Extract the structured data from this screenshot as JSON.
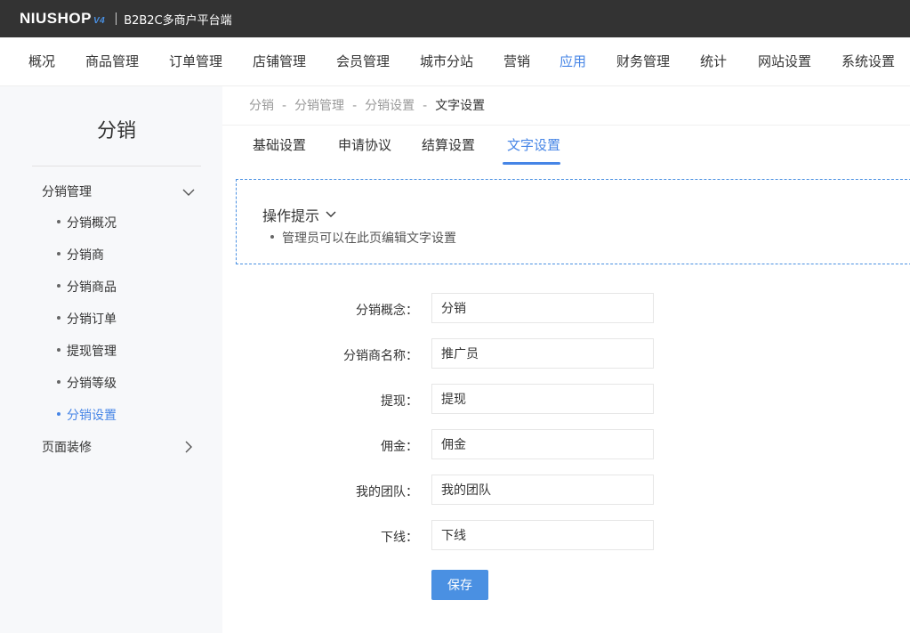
{
  "header": {
    "logo_text": "NIUSHOP",
    "logo_version": "V4",
    "platform_name": "B2B2C多商户平台端"
  },
  "nav": {
    "items": [
      {
        "label": "概况"
      },
      {
        "label": "商品管理"
      },
      {
        "label": "订单管理"
      },
      {
        "label": "店铺管理"
      },
      {
        "label": "会员管理"
      },
      {
        "label": "城市分站"
      },
      {
        "label": "营销"
      },
      {
        "label": "应用",
        "active": true
      },
      {
        "label": "财务管理"
      },
      {
        "label": "统计"
      },
      {
        "label": "网站设置"
      },
      {
        "label": "系统设置"
      }
    ]
  },
  "sidebar": {
    "title": "分销",
    "groups": [
      {
        "label": "分销管理",
        "expanded": true,
        "items": [
          {
            "label": "分销概况"
          },
          {
            "label": "分销商"
          },
          {
            "label": "分销商品"
          },
          {
            "label": "分销订单"
          },
          {
            "label": "提现管理"
          },
          {
            "label": "分销等级"
          },
          {
            "label": "分销设置",
            "active": true
          }
        ]
      },
      {
        "label": "页面装修",
        "expanded": false
      }
    ]
  },
  "breadcrumb": [
    "分销",
    "分销管理",
    "分销设置",
    "文字设置"
  ],
  "tabs": [
    {
      "label": "基础设置"
    },
    {
      "label": "申请协议"
    },
    {
      "label": "结算设置"
    },
    {
      "label": "文字设置",
      "active": true
    }
  ],
  "tips": {
    "title": "操作提示",
    "items": [
      "管理员可以在此页编辑文字设置"
    ]
  },
  "form": {
    "fields": [
      {
        "label": "分销概念：",
        "value": "分销"
      },
      {
        "label": "分销商名称：",
        "value": "推广员"
      },
      {
        "label": "提现：",
        "value": "提现"
      },
      {
        "label": "佣金：",
        "value": "佣金"
      },
      {
        "label": "我的团队：",
        "value": "我的团队"
      },
      {
        "label": "下线：",
        "value": "下线"
      }
    ],
    "save_label": "保存"
  },
  "colors": {
    "accent": "#4685e6",
    "topbar": "#333333",
    "sidebar_bg": "#f7f8fa",
    "button": "#4a90e2"
  }
}
